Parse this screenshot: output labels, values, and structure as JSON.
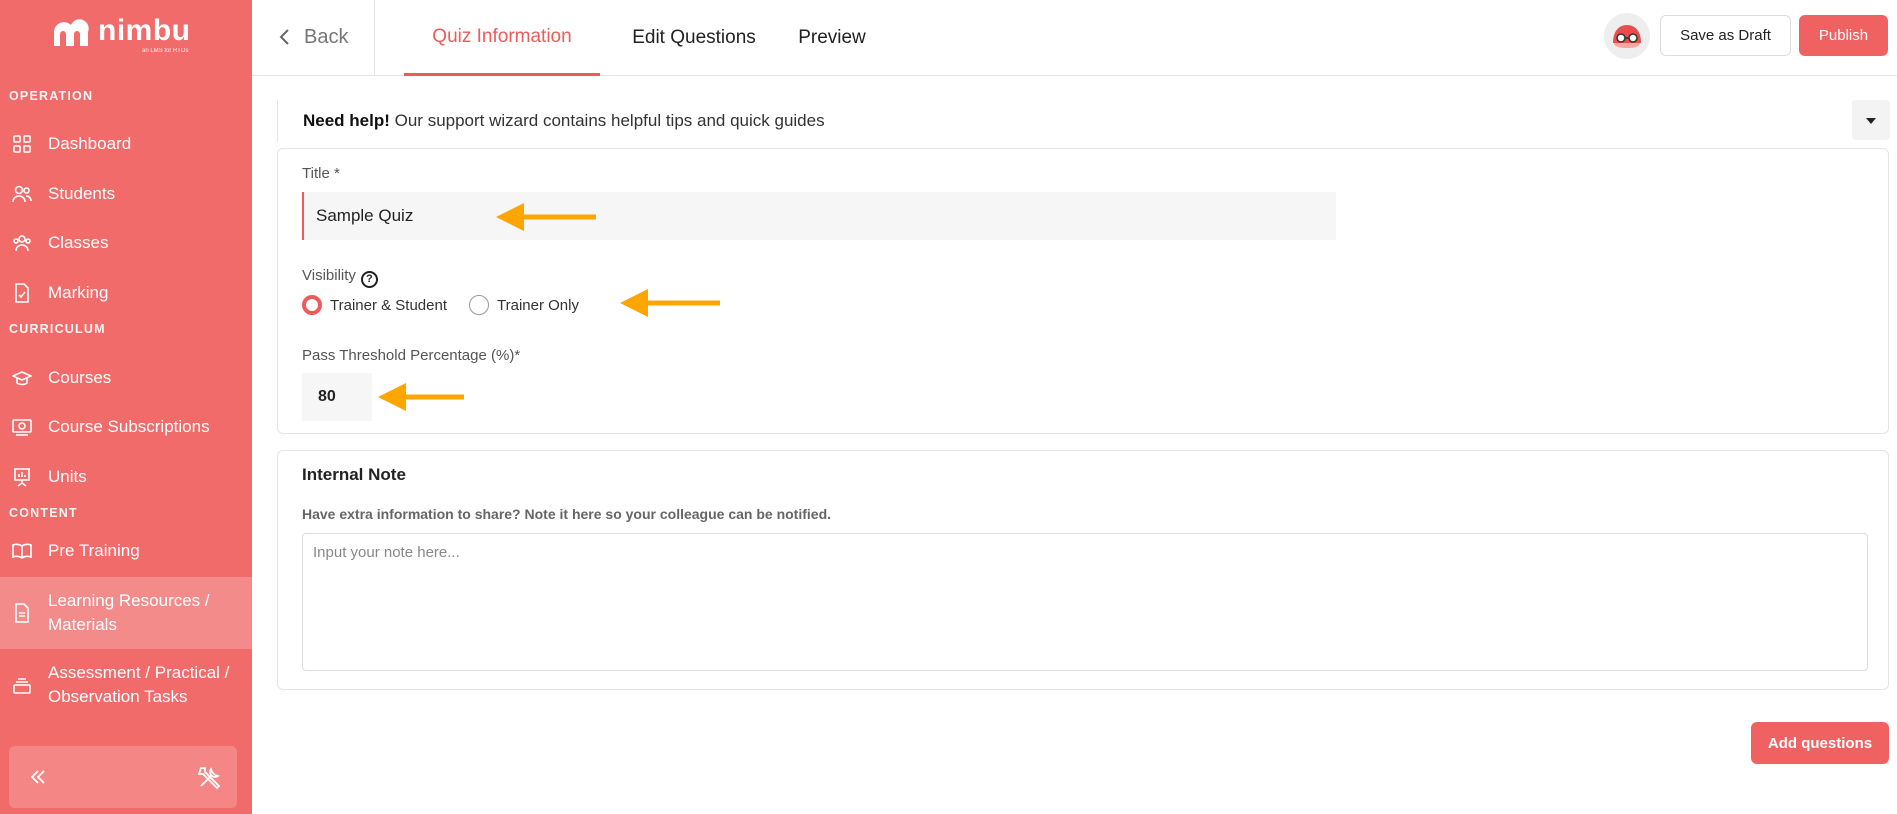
{
  "brand": {
    "name": "nimbu",
    "tagline": "an LMS for RTOs"
  },
  "sidebar": {
    "sections": [
      {
        "label": "OPERATION",
        "items": [
          {
            "label": "Dashboard",
            "icon": "grid-icon"
          },
          {
            "label": "Students",
            "icon": "users-icon"
          },
          {
            "label": "Classes",
            "icon": "group-icon"
          },
          {
            "label": "Marking",
            "icon": "marking-icon"
          }
        ]
      },
      {
        "label": "CURRICULUM",
        "items": [
          {
            "label": "Courses",
            "icon": "graduation-cap-icon"
          },
          {
            "label": "Course Subscriptions",
            "icon": "subscription-icon"
          },
          {
            "label": "Units",
            "icon": "presentation-icon"
          }
        ]
      },
      {
        "label": "CONTENT",
        "items": [
          {
            "label": "Pre Training",
            "icon": "book-icon"
          },
          {
            "label": "Learning Resources / Materials",
            "label_line1": "Learning Resources /",
            "label_line2": "Materials",
            "icon": "document-icon",
            "active": true
          },
          {
            "label": "Assessment / Practical / Observation Tasks",
            "label_line1": "Assessment / Practical /",
            "label_line2": "Observation Tasks",
            "icon": "stack-icon"
          }
        ]
      }
    ]
  },
  "topbar": {
    "back_label": "Back",
    "tabs": [
      {
        "label": "Quiz Information",
        "active": true
      },
      {
        "label": "Edit Questions"
      },
      {
        "label": "Preview"
      }
    ],
    "save_draft_label": "Save as Draft",
    "publish_label": "Publish"
  },
  "help": {
    "bold": "Need help!",
    "text": " Our support wizard contains helpful tips and quick guides"
  },
  "form": {
    "title_label": "Title *",
    "title_value": "Sample Quiz",
    "visibility_label": "Visibility",
    "visibility_options": [
      {
        "label": "Trainer & Student",
        "selected": true
      },
      {
        "label": "Trainer Only",
        "selected": false
      }
    ],
    "pass_label": "Pass Threshold Percentage (%)*",
    "pass_value": "80"
  },
  "note": {
    "title": "Internal Note",
    "subtitle": "Have extra information to share? Note it here so your colleague can be notified.",
    "placeholder": "Input your note here...",
    "value": ""
  },
  "add_questions_label": "Add questions",
  "colors": {
    "primary": "#f26b6b",
    "accent": "#ef5a5a",
    "arrow": "#ffa500"
  }
}
